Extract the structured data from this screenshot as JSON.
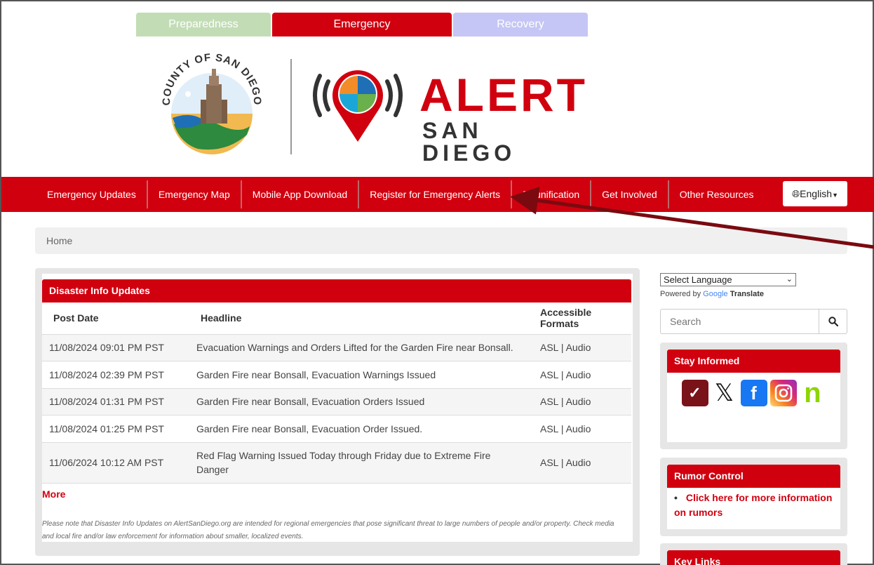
{
  "phase_tabs": [
    "Preparedness",
    "Emergency",
    "Recovery"
  ],
  "logo": {
    "seal_text": "COUNTY OF SAN DIEGO",
    "alert_word": "ALERT",
    "alert_sub": "SAN DIEGO"
  },
  "nav": {
    "items": [
      "Emergency Updates",
      "Emergency Map",
      "Mobile App Download",
      "Register for Emergency Alerts",
      "Reunification",
      "Get Involved",
      "Other Resources"
    ],
    "language_button": "English"
  },
  "breadcrumb": "Home",
  "updates": {
    "header": "Disaster Info Updates",
    "columns": [
      "Post Date",
      "Headline",
      "Accessible Formats"
    ],
    "rows": [
      {
        "date": "11/08/2024 09:01 PM PST",
        "headline": "Evacuation Warnings and Orders Lifted for the Garden Fire near Bonsall.",
        "formats": "ASL | Audio"
      },
      {
        "date": "11/08/2024 02:39 PM PST",
        "headline": "Garden Fire near Bonsall, Evacuation Warnings Issued",
        "formats": "ASL | Audio"
      },
      {
        "date": "11/08/2024 01:31 PM PST",
        "headline": "Garden Fire near Bonsall, Evacuation Orders Issued",
        "formats": "ASL | Audio"
      },
      {
        "date": "11/08/2024 01:25 PM PST",
        "headline": "Garden Fire near Bonsall, Evacuation Order Issued.",
        "formats": "ASL | Audio"
      },
      {
        "date": "11/06/2024 10:12 AM PST",
        "headline": "Red Flag Warning Issued Today through Friday due to Extreme Fire Danger",
        "formats": "ASL | Audio"
      }
    ],
    "more": "More",
    "disclaimer": "Please note that Disaster Info Updates on AlertSanDiego.org are intended for regional emergencies that pose significant threat to large numbers of people and/or property. Check media and local fire and/or law enforcement for information about smaller, localized events."
  },
  "sidebar": {
    "select_language": "Select Language",
    "powered_by": "Powered by",
    "google": "Google",
    "translate": "Translate",
    "search_placeholder": "Search",
    "stay_informed": "Stay Informed",
    "social_icons": [
      "checkmark-icon",
      "x-icon",
      "facebook-icon",
      "instagram-icon",
      "nextdoor-icon"
    ],
    "rumor_control": "Rumor Control",
    "rumor_link": "Click here for more information on rumors",
    "key_links": "Key Links"
  },
  "colors": {
    "brand_red": "#d1000f",
    "preparedness": "#c2ddb5",
    "recovery": "#c5c6f5"
  }
}
